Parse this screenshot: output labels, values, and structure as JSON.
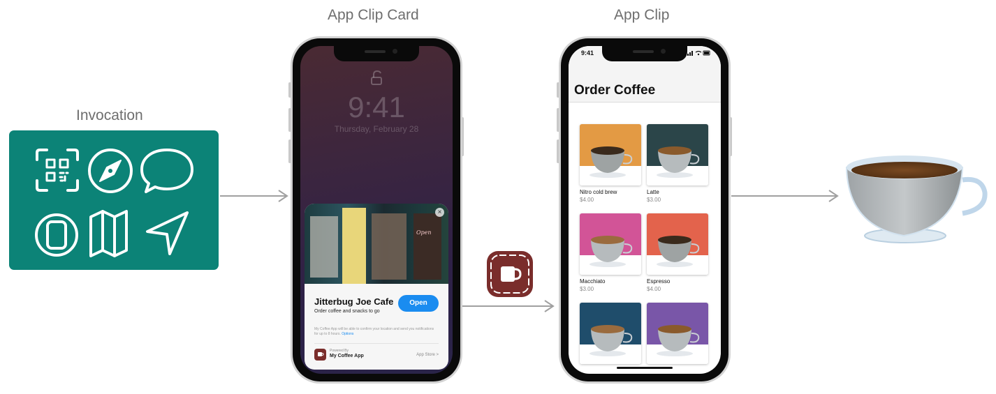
{
  "labels": {
    "invocation": "Invocation",
    "app_clip_card": "App Clip Card",
    "app_clip": "App Clip"
  },
  "invocation_icons": [
    "qr-code-icon",
    "safari-compass-icon",
    "message-bubble-icon",
    "app-clip-code-icon",
    "maps-icon",
    "location-arrow-icon"
  ],
  "lock_screen": {
    "time": "9:41",
    "date": "Thursday, February 28"
  },
  "clip_card": {
    "title": "Jitterbug Joe Cafe",
    "subtitle": "Order coffee and snacks to go",
    "open_label": "Open",
    "close_label": "×",
    "fine_print": "My Coffee App will be able to confirm your location and send you notifications for up to 8 hours.",
    "options_link": "Options",
    "powered_by": "Powered By",
    "app_name": "My Coffee App",
    "store_link": "App Store >"
  },
  "app_clip": {
    "status_time": "9:41",
    "title": "Order Coffee",
    "items": [
      {
        "name": "Nitro cold brew",
        "price": "$4.00"
      },
      {
        "name": "Latte",
        "price": "$3.00"
      },
      {
        "name": "Macchiato",
        "price": "$3.00"
      },
      {
        "name": "Espresso",
        "price": "$4.00"
      },
      {
        "name": "",
        "price": ""
      },
      {
        "name": "",
        "price": ""
      }
    ]
  },
  "colors": {
    "invocation_bg": "#0c8377",
    "open_button": "#1a8cf0",
    "app_icon": "#7a2d2b",
    "arrow": "#a0a0a0",
    "tile_orange": "#e39a44",
    "tile_darkteal": "#2b4549",
    "tile_pink": "#d25497",
    "tile_coral": "#e3634c",
    "tile_navy": "#1f4d6b",
    "tile_purple": "#7956a8"
  }
}
